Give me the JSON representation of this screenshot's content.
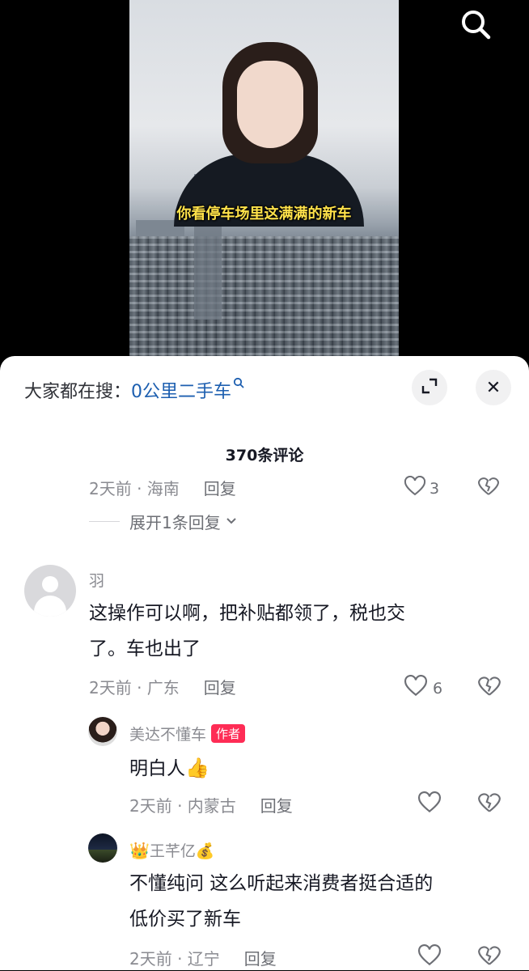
{
  "video": {
    "subtitle": "你看停车场里这满满的新车",
    "search_icon": "search-icon"
  },
  "hot_search": {
    "prefix": "大家都在搜：",
    "term": "0公里二手车",
    "term_icon": "search-icon"
  },
  "sheet": {
    "expand_icon": "expand-icon",
    "close_label": "✕",
    "comment_count": "370条评论"
  },
  "prev_comment": {
    "time_location": "2天前 · 海南",
    "reply": "回复",
    "likes": "3",
    "expand_replies": "展开1条回复"
  },
  "comments": [
    {
      "username": "羽",
      "text_line1": "这操作可以啊，把补贴都领了，税也交",
      "text_line2": "了。车也出了",
      "time_location": "2天前 · 广东",
      "reply": "回复",
      "likes": "6"
    },
    {
      "username": "美达不懂车",
      "badge": "作者",
      "text": "明白人",
      "emoji": "👍",
      "time_location": "2天前 · 内蒙古",
      "reply": "回复"
    },
    {
      "username_prefix": "👑",
      "username": "王芊亿",
      "username_suffix": "💰",
      "text_line1": "不懂纯问 这么听起来消费者挺合适的",
      "text_line2": "低价买了新车",
      "time_location": "2天前 · 辽宁",
      "reply": "回复"
    }
  ]
}
